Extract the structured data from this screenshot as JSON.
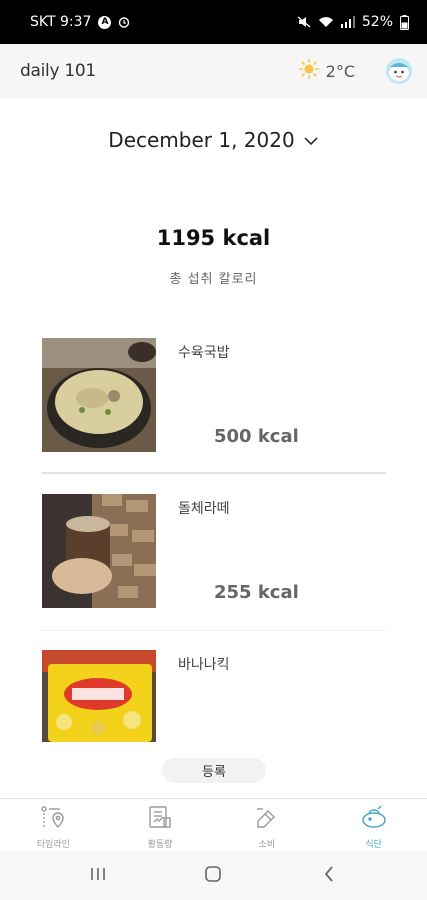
{
  "status": {
    "carrier_time": "SKT 9:37",
    "battery": "52%"
  },
  "header": {
    "logo": "daily 101",
    "temperature": "2°C",
    "weather_icon": "sun-icon",
    "avatar_icon": "character-avatar-icon"
  },
  "date": {
    "label": "December 1, 2020"
  },
  "summary": {
    "total_kcal": "1195 kcal",
    "total_label": "총 섭취 칼로리"
  },
  "meals": [
    {
      "name": "수육국밥",
      "kcal": "500 kcal"
    },
    {
      "name": "돌체라떼",
      "kcal": "255 kcal"
    },
    {
      "name": "바나나킥",
      "kcal": ""
    }
  ],
  "register_label": "등록",
  "tabs": [
    {
      "label": "타임라인",
      "icon": "timeline-icon"
    },
    {
      "label": "활동량",
      "icon": "activity-icon"
    },
    {
      "label": "소비",
      "icon": "spending-icon"
    },
    {
      "label": "식단",
      "icon": "diet-icon"
    }
  ],
  "colors": {
    "accent": "#4aa6c9",
    "header_bg": "#f6f6f6"
  }
}
